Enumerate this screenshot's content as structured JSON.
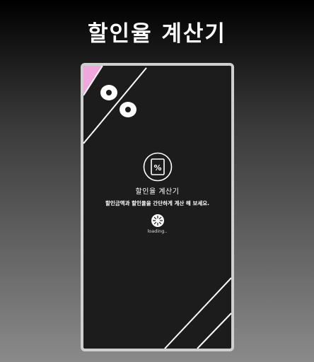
{
  "headline": "할인율 계산기",
  "splash": {
    "app_name": "할인율 계산기",
    "description": "할인금액과 할인율을 간단하게 계산 해 보세요.",
    "loading": "loading..",
    "icon_symbol": "%"
  },
  "colors": {
    "background_top": "#000000",
    "background_bottom": "#8a8a8a",
    "phone_frame": "#cfcfcf",
    "phone_screen": "#1c1c1c",
    "accent_pink": "#f0a8dc",
    "text": "#ffffff"
  },
  "icons": [
    "percent-app-icon",
    "loading-spinner-icon"
  ]
}
